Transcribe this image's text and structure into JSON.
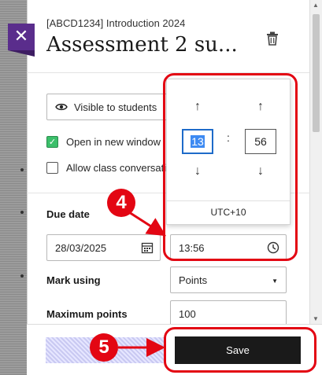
{
  "header": {
    "course": "[ABCD1234] Introduction 2024",
    "title": "Assessment 2 su..."
  },
  "settings": {
    "visible_label": "Visible to students",
    "open_new_window_label": "Open in new window",
    "open_new_window_checked": true,
    "allow_conversation_label": "Allow class conversati",
    "allow_conversation_checked": false
  },
  "due": {
    "label": "Due date",
    "date_value": "28/03/2025",
    "time_value": "13:56"
  },
  "time_picker": {
    "hour": "13",
    "minute": "56",
    "separator": ":",
    "timezone": "UTC+10"
  },
  "grading": {
    "mark_label": "Mark using",
    "mark_value": "Points",
    "max_label": "Maximum points",
    "max_value": "100"
  },
  "footer": {
    "save_label": "Save"
  },
  "callouts": {
    "step4": "4",
    "step5": "5"
  },
  "colors": {
    "callout": "#e30613",
    "brand_purple": "#5a2d8c",
    "check_green": "#3bbf6a",
    "save_bg": "#1a1a1a"
  }
}
